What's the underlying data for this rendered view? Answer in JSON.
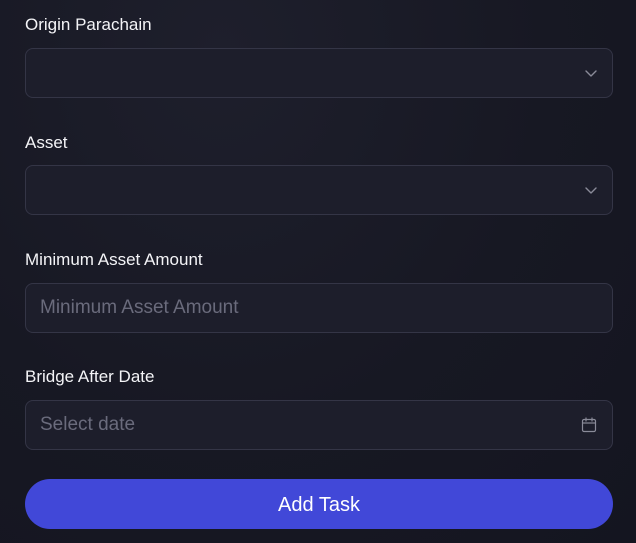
{
  "form": {
    "origin_parachain": {
      "label": "Origin Parachain",
      "value": ""
    },
    "asset": {
      "label": "Asset",
      "value": ""
    },
    "minimum_asset_amount": {
      "label": "Minimum Asset Amount",
      "value": "",
      "placeholder": "Minimum Asset Amount"
    },
    "bridge_after_date": {
      "label": "Bridge After Date",
      "placeholder": "Select date",
      "icon": "calendar-icon"
    },
    "select_icon": "chevron-down-icon",
    "submit_label": "Add Task"
  },
  "colors": {
    "background": "#171823",
    "field_background": "#1d1e2b",
    "field_border": "#343546",
    "placeholder": "#6a6b7c",
    "accent": "#4148d8"
  }
}
